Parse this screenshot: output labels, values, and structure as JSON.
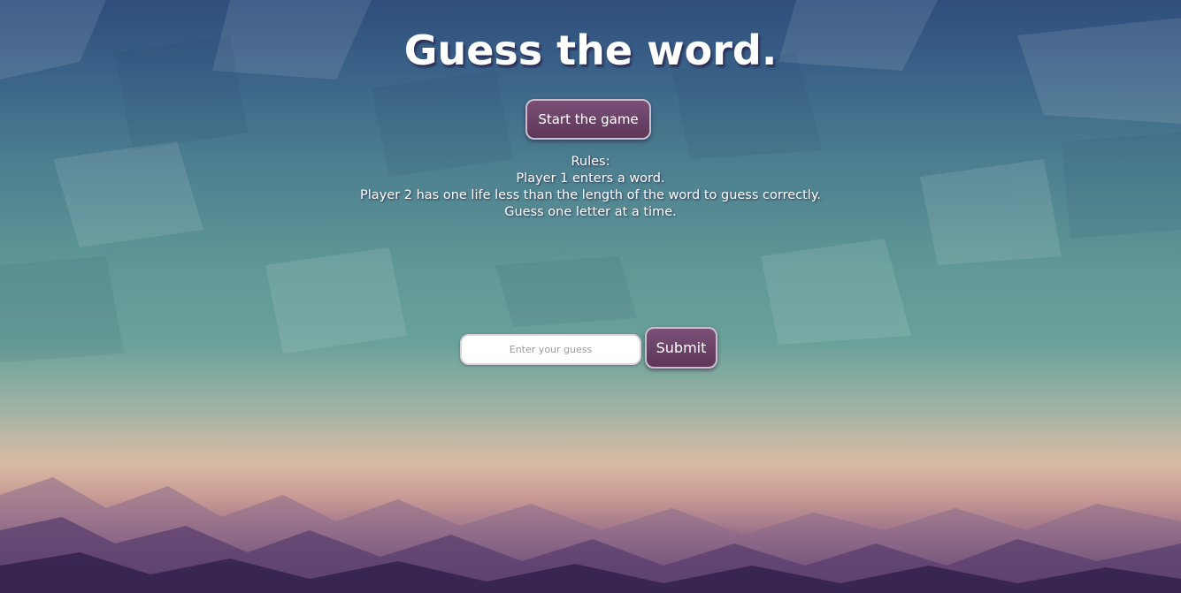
{
  "page": {
    "title": "Guess the word."
  },
  "controls": {
    "start_label": "Start the game",
    "submit_label": "Submit"
  },
  "rules": {
    "heading": "Rules:",
    "lines": [
      "Player 1 enters a word.",
      "Player 2 has one life less than the length of the word to guess correctly.",
      "Guess one letter at a time."
    ]
  },
  "guess": {
    "placeholder": "Enter your guess",
    "value": ""
  },
  "colors": {
    "button": "#6a4267",
    "button_border": "#c8c0cc",
    "text": "#ffffff"
  }
}
